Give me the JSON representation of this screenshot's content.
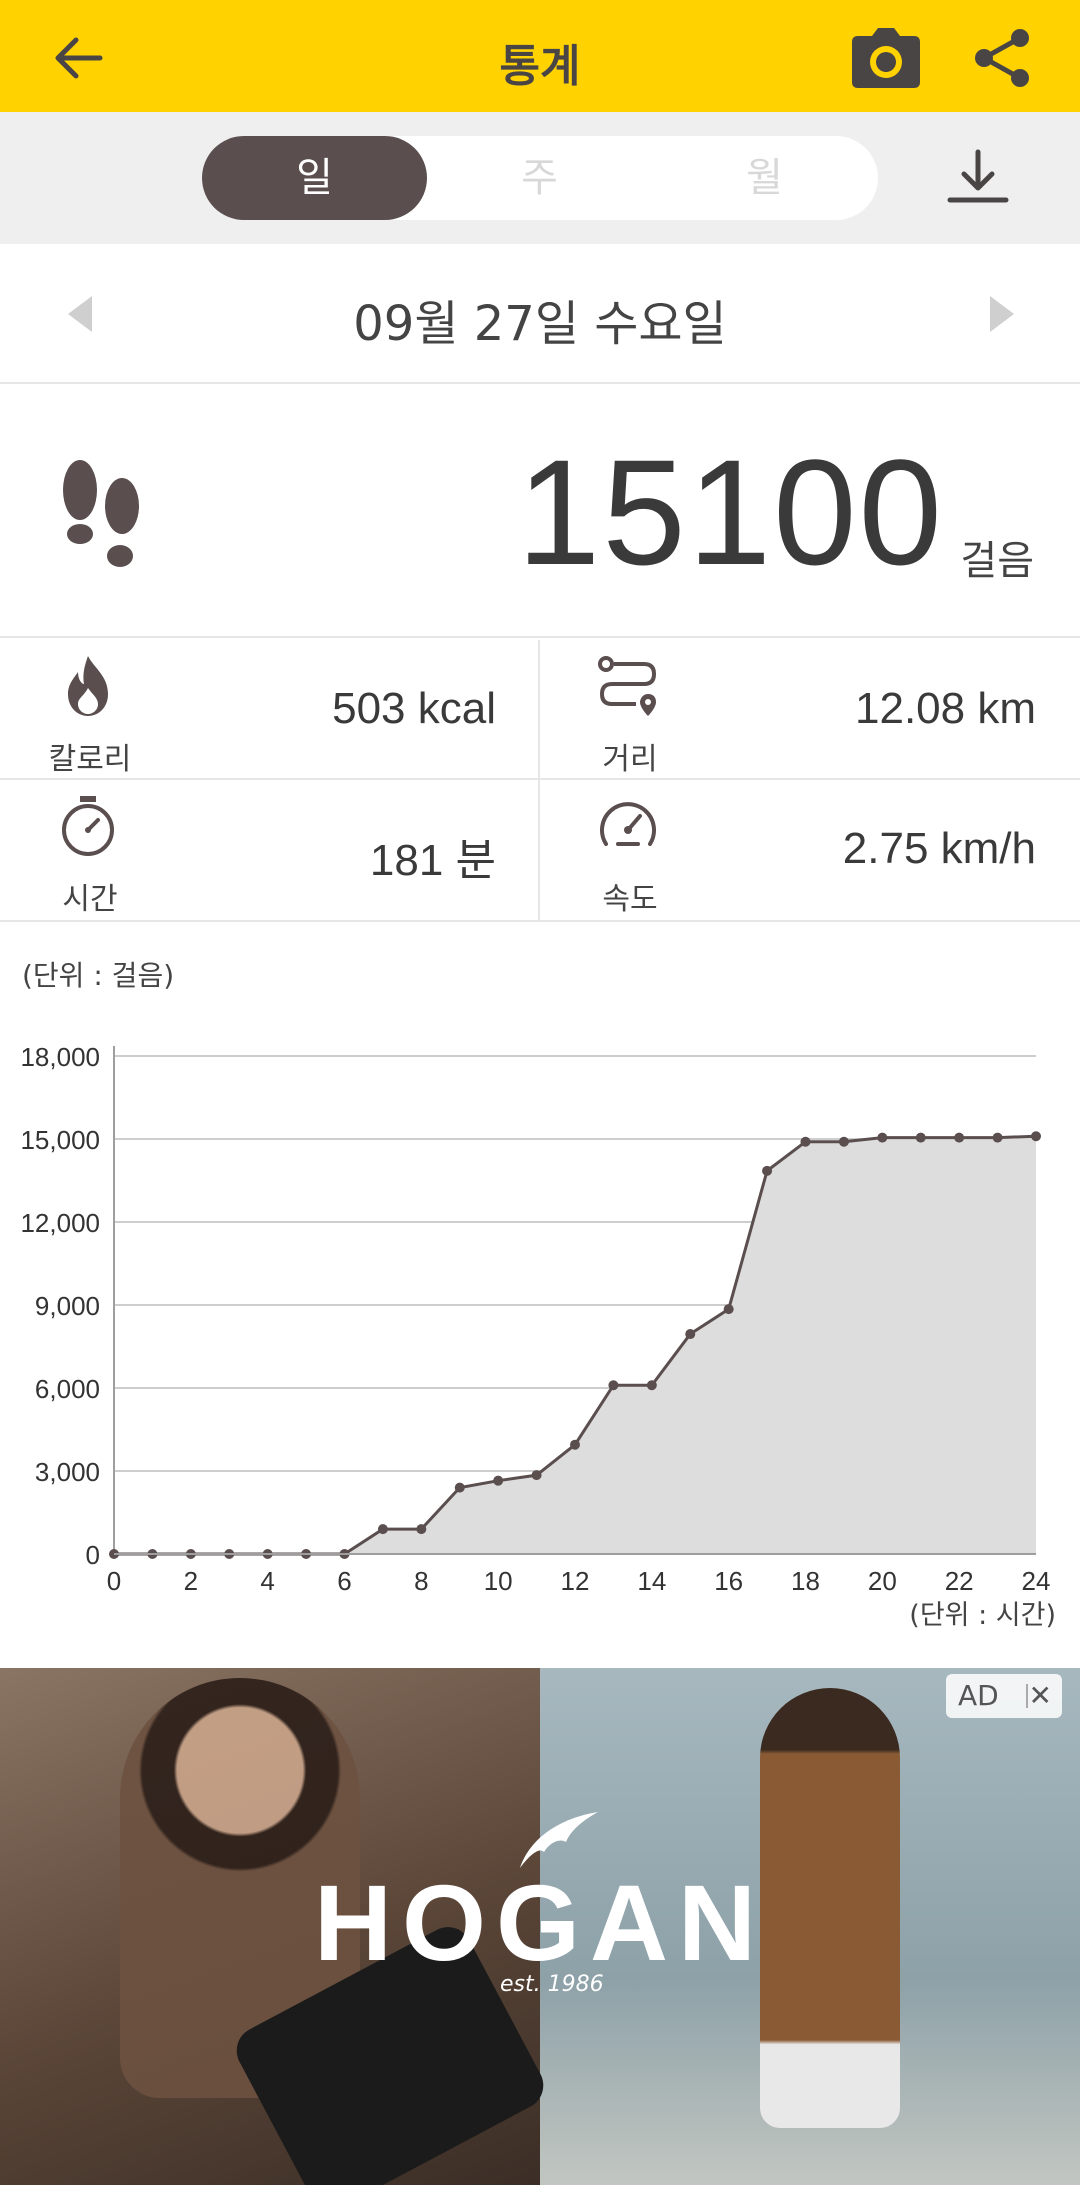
{
  "header": {
    "title": "통계",
    "back_icon": "arrow-left-icon",
    "camera_icon": "camera-icon",
    "share_icon": "share-icon",
    "bg_color": "#FFD200"
  },
  "period_tabs": {
    "items": [
      "일",
      "주",
      "월"
    ],
    "selected": "일",
    "download_icon": "download-icon"
  },
  "date_nav": {
    "date": "09월 27일 수요일"
  },
  "steps": {
    "count": "15100",
    "unit": "걸음"
  },
  "stats": [
    {
      "label": "칼로리",
      "value": "503 kcal",
      "icon": "flame-icon"
    },
    {
      "label": "거리",
      "value": "12.08 km",
      "icon": "route-icon"
    },
    {
      "label": "시간",
      "value": "181 분",
      "icon": "stopwatch-icon"
    },
    {
      "label": "속도",
      "value": "2.75 km/h",
      "icon": "speedometer-icon"
    }
  ],
  "chart_data": {
    "type": "area",
    "ylabel": "(단위 : 걸음)",
    "xlabel": "(단위 : 시간)",
    "x": [
      0,
      1,
      2,
      3,
      4,
      5,
      6,
      7,
      8,
      9,
      10,
      11,
      12,
      13,
      14,
      15,
      16,
      17,
      18,
      19,
      20,
      21,
      22,
      23,
      24
    ],
    "values": [
      0,
      0,
      0,
      0,
      0,
      0,
      0,
      900,
      900,
      2400,
      2650,
      2850,
      3950,
      6100,
      6100,
      7950,
      8850,
      13850,
      14900,
      14900,
      15050,
      15050,
      15050,
      15050,
      15100
    ],
    "xticks": [
      "0",
      "2",
      "4",
      "6",
      "8",
      "10",
      "12",
      "14",
      "16",
      "18",
      "20",
      "22",
      "24"
    ],
    "yticks": [
      "0",
      "3,000",
      "6,000",
      "9,000",
      "12,000",
      "15,000",
      "18,000"
    ],
    "xlim": [
      0,
      24
    ],
    "ylim": [
      0,
      18000
    ],
    "grid": true,
    "line_color": "#5a4e4e",
    "fill_color": "#dedddd"
  },
  "ad": {
    "brand": "HOGAN",
    "tagline": "est. 1986",
    "badge": "AD",
    "close": "✕"
  }
}
